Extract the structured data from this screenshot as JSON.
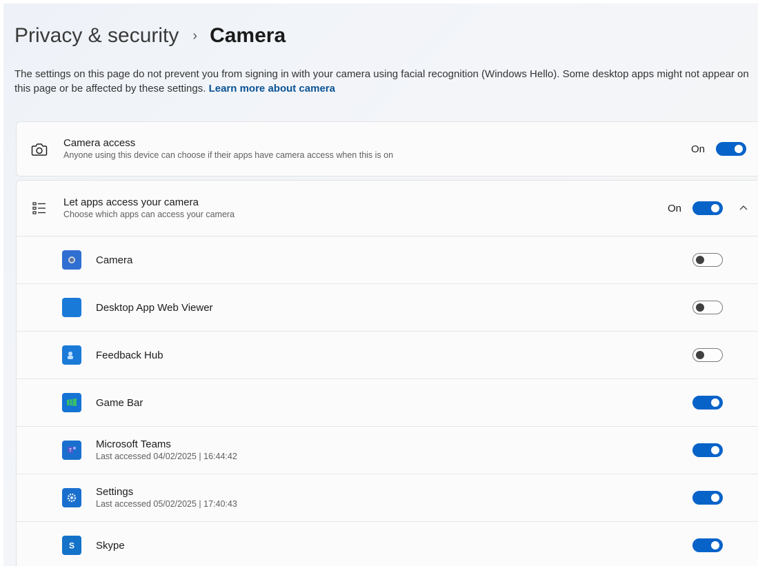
{
  "header": {
    "parent": "Privacy & security",
    "separator": "›",
    "current": "Camera"
  },
  "description": {
    "text": "The settings on this page do not prevent you from signing in with your camera using facial recognition (Windows Hello). Some desktop apps might not appear on this page or be affected by these settings.",
    "link": "Learn more about camera"
  },
  "camera_access": {
    "icon": "camera-outline-icon",
    "title": "Camera access",
    "subtitle": "Anyone using this device can choose if their apps have camera access when this is on",
    "state": "On",
    "enabled": true
  },
  "let_apps": {
    "icon": "list-icon",
    "title": "Let apps access your camera",
    "subtitle": "Choose which apps can access your camera",
    "state": "On",
    "enabled": true,
    "expand_icon": "chevron-up-icon"
  },
  "apps": [
    {
      "name": "Camera",
      "subtitle": "",
      "state": "Off",
      "enabled": false,
      "icon": "camera-app-icon",
      "color": "#2f6fd1"
    },
    {
      "name": "Desktop App Web Viewer",
      "subtitle": "",
      "state": "Off",
      "enabled": false,
      "icon": "web-viewer-icon",
      "color": "#1a7ad8"
    },
    {
      "name": "Feedback Hub",
      "subtitle": "",
      "state": "Off",
      "enabled": false,
      "icon": "feedback-hub-icon",
      "color": "#1a7ad8"
    },
    {
      "name": "Game Bar",
      "subtitle": "",
      "state": "On",
      "enabled": true,
      "icon": "game-bar-icon",
      "color": "#1473d4"
    },
    {
      "name": "Microsoft Teams",
      "subtitle": "Last accessed 04/02/2025  |  16:44:42",
      "state": "On",
      "enabled": true,
      "icon": "teams-icon",
      "color": "#1a6fce"
    },
    {
      "name": "Settings",
      "subtitle": "Last accessed 05/02/2025  |  17:40:43",
      "state": "On",
      "enabled": true,
      "icon": "settings-app-icon",
      "color": "#1a6fce"
    },
    {
      "name": "Skype",
      "subtitle": "",
      "state": "On",
      "enabled": true,
      "icon": "skype-icon",
      "color": "#1572c9"
    }
  ],
  "colors": {
    "accent": "#0863c9",
    "link": "#0b5394"
  }
}
